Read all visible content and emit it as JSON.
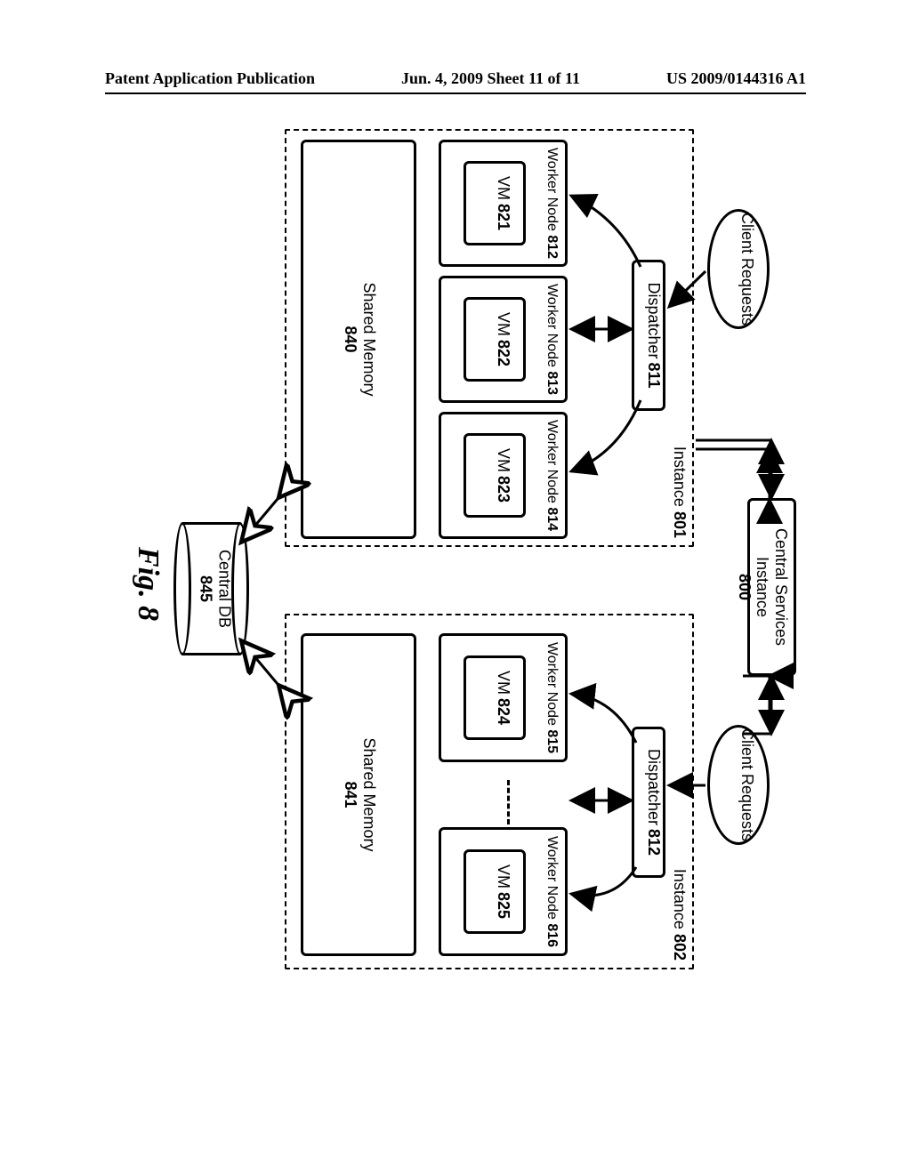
{
  "header": {
    "left": "Patent Application Publication",
    "mid": "Jun. 4, 2009  Sheet 11 of 11",
    "right": "US 2009/0144316 A1"
  },
  "diagram": {
    "central_services_label": "Central Services Instance",
    "central_services_ref": "800",
    "client_requests": "Client Requests",
    "instance801": {
      "title": "Instance",
      "ref": "801",
      "dispatcher_label": "Dispatcher",
      "dispatcher_ref": "811",
      "worker_label": "Worker Node",
      "workers": [
        {
          "ref": "812",
          "vm": "821"
        },
        {
          "ref": "813",
          "vm": "822"
        },
        {
          "ref": "814",
          "vm": "823"
        }
      ],
      "vm_label": "VM",
      "shared_label": "Shared Memory",
      "shared_ref": "840"
    },
    "instance802": {
      "title": "Instance",
      "ref": "802",
      "dispatcher_label": "Dispatcher",
      "dispatcher_ref": "812",
      "worker_label": "Worker Node",
      "workers": [
        {
          "ref": "815",
          "vm": "824"
        },
        {
          "ref": "816",
          "vm": "825"
        }
      ],
      "vm_label": "VM",
      "shared_label": "Shared Memory",
      "shared_ref": "841"
    },
    "central_db_label": "Central DB",
    "central_db_ref": "845",
    "fig_caption": "Fig. 8"
  }
}
